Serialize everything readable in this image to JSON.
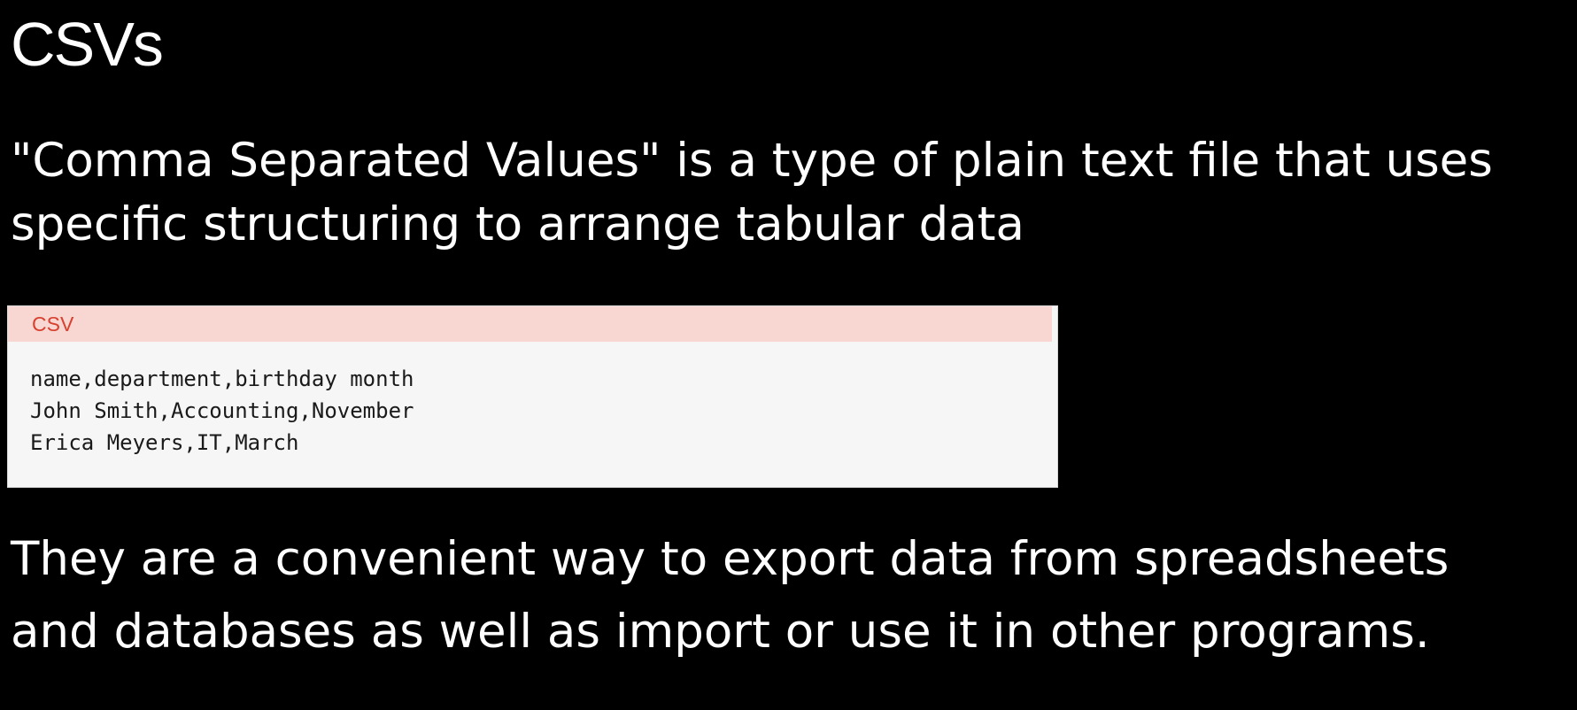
{
  "slide": {
    "title": "CSVs",
    "paragraph_1": {
      "lines": [
        "\"Comma Separated Values\" is a type of plain text file that uses",
        "specific structuring to arrange tabular data"
      ]
    },
    "code_block": {
      "language_label": "CSV",
      "lines": [
        "name,department,birthday month",
        "John Smith,Accounting,November",
        "Erica Meyers,IT,March"
      ]
    },
    "paragraph_2": {
      "lines": [
        "They are a convenient way to export data from spreadsheets",
        "and databases as well as import or use it in other programs."
      ]
    }
  },
  "colors": {
    "background": "#000000",
    "text": "#ffffff",
    "code_header_bg": "#f8d6d1",
    "code_header_text": "#d8412f",
    "code_bg": "#f6f6f6"
  }
}
